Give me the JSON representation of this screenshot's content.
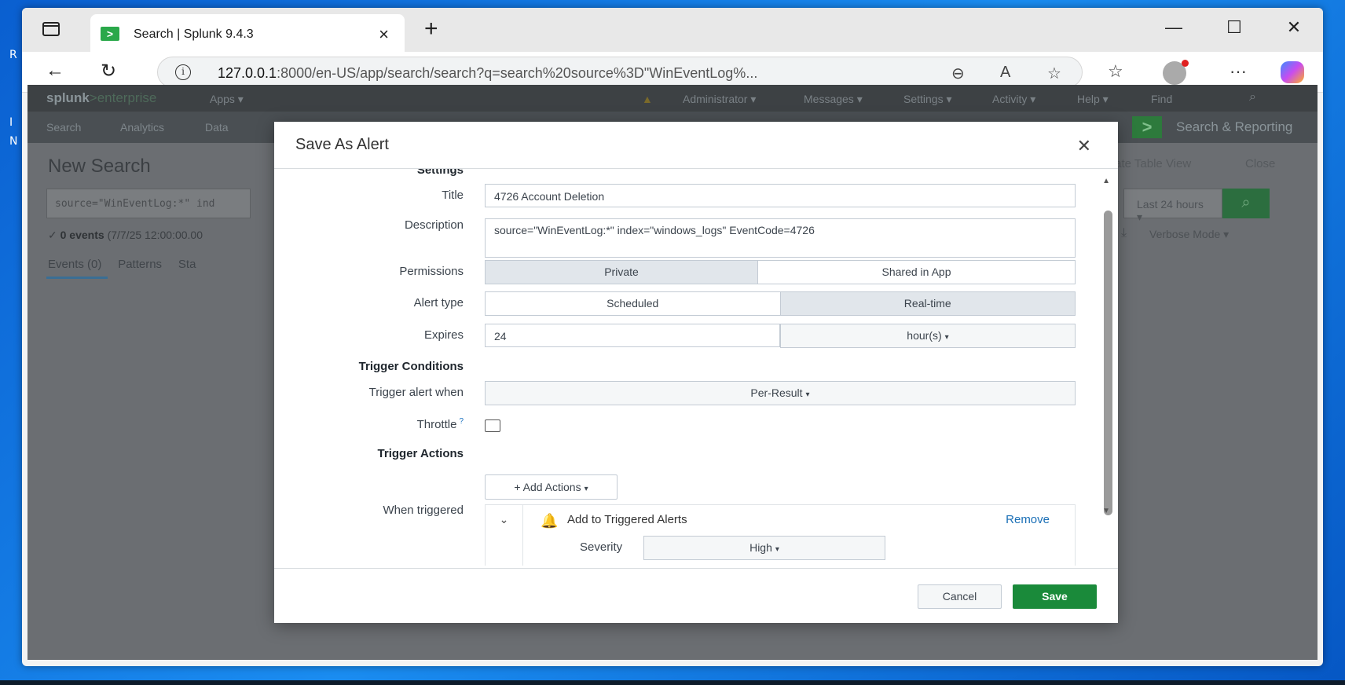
{
  "desktop": {
    "frag1": "R",
    "frag2": "I",
    "frag3": "N"
  },
  "browser": {
    "tab_title": "Search | Splunk 9.4.3",
    "tab_favicon": ">",
    "url_host": "127.0.0.1",
    "url_rest": ":8000/en-US/app/search/search?q=search%20source%3D\"WinEventLog%..."
  },
  "splunk": {
    "logo_a": "splunk",
    "logo_b": ">enterprise",
    "apps": "Apps ▾",
    "top_menu": [
      "Administrator ▾",
      "Messages ▾",
      "Settings ▾",
      "Activity ▾",
      "Help ▾",
      "Find"
    ],
    "nav": [
      "Search",
      "Analytics",
      "Data"
    ],
    "app_icon": ">",
    "app_name": "Search & Reporting",
    "page_title": "New Search",
    "search_query": "source=\"WinEventLog:*\" ind",
    "time_range": "Last 24 hours ▾",
    "events_count": "0 events",
    "events_range": "(7/7/25 12:00:00.00",
    "result_tabs": "Events (0)     Patterns     Sta",
    "create_table_view": "Create Table View",
    "close_link": "Close",
    "verbose": "Verbose Mode ▾"
  },
  "modal": {
    "title": "Save As Alert",
    "section_settings": "Settings",
    "title_label": "Title",
    "title_value": "4726 Account Deletion",
    "description_label": "Description",
    "description_value": "source=\"WinEventLog:*\" index=\"windows_logs\" EventCode=4726",
    "permissions_label": "Permissions",
    "permissions_options": [
      "Private",
      "Shared in App"
    ],
    "permissions_selected": "Private",
    "alert_type_label": "Alert type",
    "alert_type_options": [
      "Scheduled",
      "Real-time"
    ],
    "alert_type_selected": "Real-time",
    "expires_label": "Expires",
    "expires_value": "24",
    "expires_unit": "hour(s)",
    "trigger_conditions": "Trigger Conditions",
    "trigger_when_label": "Trigger alert when",
    "trigger_when_value": "Per-Result",
    "throttle_label": "Throttle",
    "throttle_help": "?",
    "throttle_checked": false,
    "trigger_actions": "Trigger Actions",
    "add_actions": "+ Add Actions",
    "when_triggered_label": "When triggered",
    "action_name": "Add to Triggered Alerts",
    "remove_label": "Remove",
    "severity_label": "Severity",
    "severity_value": "High",
    "cancel": "Cancel",
    "save": "Save"
  }
}
